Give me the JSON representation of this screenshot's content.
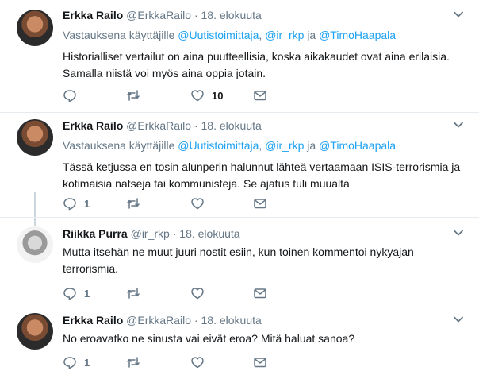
{
  "tweets": [
    {
      "name": "Erkka Railo",
      "handle": "@ErkkaRailo",
      "dot": "·",
      "time": "18. elokuuta",
      "reply_prefix": "Vastauksena käyttäjille",
      "mention1": "@Uutistoimittaja",
      "sep1": ",",
      "mention2": "@ir_rkp",
      "sep2": "ja",
      "mention3": "@TimoHaapala",
      "text": "Historialliset vertailut on aina puutteellisia, koska aikakaudet ovat aina erilaisia. Samalla niistä voi myös aina oppia jotain.",
      "reply_count": "",
      "retweet_count": "",
      "like_count": "10"
    },
    {
      "name": "Erkka Railo",
      "handle": "@ErkkaRailo",
      "dot": "·",
      "time": "18. elokuuta",
      "reply_prefix": "Vastauksena käyttäjille",
      "mention1": "@Uutistoimittaja",
      "sep1": ",",
      "mention2": "@ir_rkp",
      "sep2": "ja",
      "mention3": "@TimoHaapala",
      "text": "Tässä ketjussa en tosin alunperin halunnut lähteä vertaamaan ISIS-terrorismia ja kotimaisia natseja tai kommunisteja. Se ajatus tuli muualta",
      "reply_count": "1",
      "retweet_count": "",
      "like_count": ""
    },
    {
      "name": "Riikka Purra",
      "handle": "@ir_rkp",
      "dot": "·",
      "time": "18. elokuuta",
      "text": "Mutta itsehän ne muut juuri nostit esiin, kun toinen kommentoi nykyajan terrorismia.",
      "reply_count": "1",
      "retweet_count": "",
      "like_count": ""
    },
    {
      "name": "Erkka Railo",
      "handle": "@ErkkaRailo",
      "dot": "·",
      "time": "18. elokuuta",
      "text": "No eroavatko ne sinusta vai eivät eroa? Mitä haluat sanoa?",
      "reply_count": "1",
      "retweet_count": "",
      "like_count": ""
    }
  ],
  "icons": {
    "caret": "chevron-down-icon",
    "reply": "reply-icon",
    "retweet": "retweet-icon",
    "like": "heart-icon",
    "dm": "envelope-icon"
  },
  "colors": {
    "mention": "#1da1f2",
    "secondary_text": "#657786",
    "divider": "#e6ecf0"
  }
}
